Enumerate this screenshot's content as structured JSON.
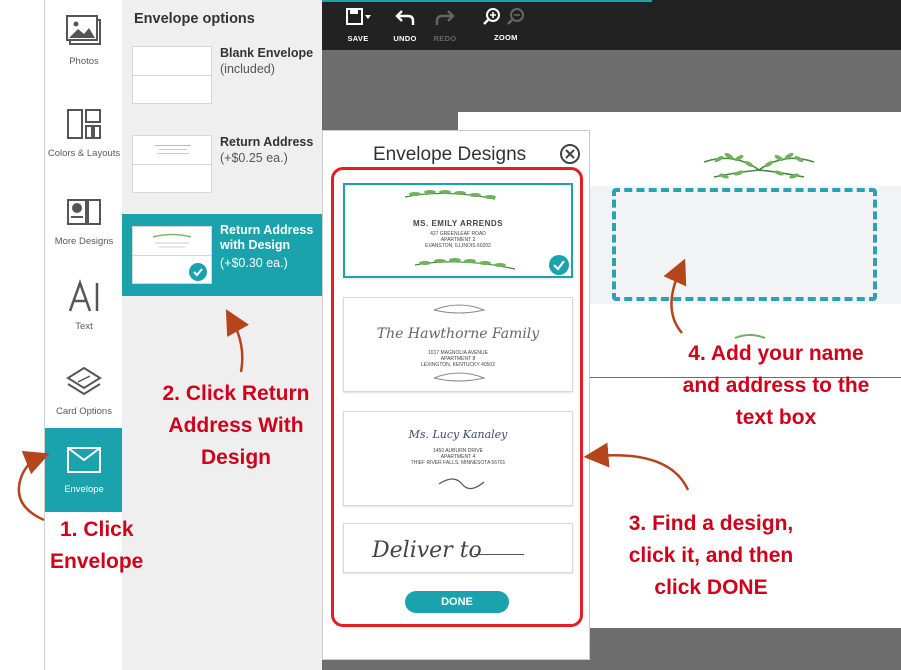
{
  "sidebar": {
    "items": [
      {
        "label": "Photos"
      },
      {
        "label": "Colors & Layouts"
      },
      {
        "label": "More Designs"
      },
      {
        "label": "Text"
      },
      {
        "label": "Card Options"
      },
      {
        "label": "Envelope"
      }
    ]
  },
  "envelope_options": {
    "title": "Envelope options",
    "options": [
      {
        "title": "Blank Envelope",
        "subtitle": "(included)"
      },
      {
        "title": "Return Address",
        "subtitle": "(+$0.25 ea.)"
      },
      {
        "title": "Return Address with Design",
        "subtitle": "(+$0.30 ea.)"
      }
    ]
  },
  "toolbar": {
    "save": "SAVE",
    "undo": "UNDO",
    "redo": "REDO",
    "zoom": "ZOOM"
  },
  "modal": {
    "title": "Envelope Designs",
    "done_label": "DONE",
    "designs": [
      {
        "name": "MS. EMILY ARRENDS",
        "lines": [
          "427 GREENLEAF ROAD",
          "APARTMENT 2",
          "EVANSTON, ILLINOIS 60202"
        ]
      },
      {
        "name": "The Hawthorne Family",
        "lines": [
          "1017 MAGNOLIA AVENUE",
          "APARTMENT 8",
          "LEXINGTON, KENTUCKY 40502"
        ]
      },
      {
        "name": "Ms. Lucy Kanaley",
        "lines": [
          "1450 AUBURN DRIVE",
          "APARTMENT 4",
          "THIEF RIVER FALLS, MINNESOTA 56701"
        ]
      },
      {
        "name": "Deliver to"
      }
    ]
  },
  "annotations": {
    "step1": [
      "1. Click",
      "Envelope"
    ],
    "step2": [
      "2. Click Return",
      "Address With",
      "Design"
    ],
    "step3": [
      "3. Find a design,",
      "click it, and then",
      "click DONE"
    ],
    "step4": [
      "4. Add your name",
      "and address to the",
      "text box"
    ]
  },
  "colors": {
    "accent": "#1aa3ad",
    "annotation": "#d0021b",
    "highlight": "#e31e24",
    "toolbar": "#222222"
  }
}
